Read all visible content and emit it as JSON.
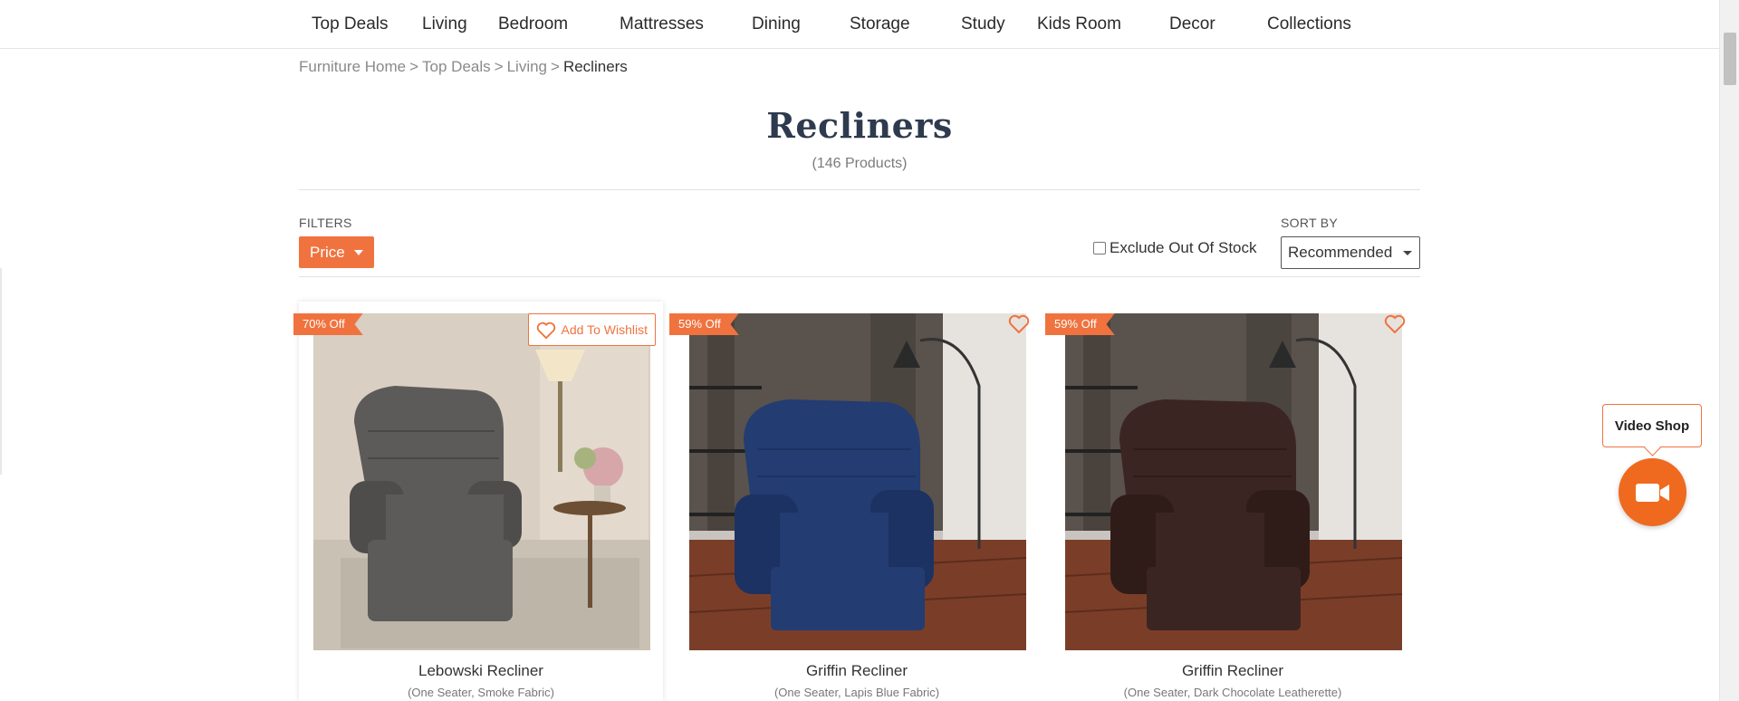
{
  "nav": {
    "items": [
      "Top Deals",
      "Living",
      "Bedroom",
      "Mattresses",
      "Dining",
      "Storage",
      "Study",
      "Kids Room",
      "Decor",
      "Collections"
    ]
  },
  "breadcrumb": {
    "items": [
      "Furniture Home",
      "Top Deals",
      "Living"
    ],
    "current": "Recliners",
    "separator": ">"
  },
  "page": {
    "title": "Recliners",
    "count": "(146 Products)"
  },
  "filters": {
    "label": "FILTERS",
    "price_label": "Price",
    "exclude_label": "Exclude Out Of Stock",
    "sort_label": "SORT BY",
    "sort_value": "Recommended"
  },
  "products": [
    {
      "badge": "70% Off",
      "wishlist": "Add To Wishlist",
      "name": "Lebowski Recliner",
      "variant": "(One Seater, Smoke Fabric)",
      "color": "#5d5b59"
    },
    {
      "badge": "59% Off",
      "wishlist": "",
      "name": "Griffin Recliner",
      "variant": "(One Seater, Lapis Blue Fabric)",
      "color": "#233c72"
    },
    {
      "badge": "59% Off",
      "wishlist": "",
      "name": "Griffin Recliner",
      "variant": "(One Seater, Dark Chocolate Leatherette)",
      "color": "#3b2522"
    }
  ],
  "video_shop": {
    "label": "Video Shop",
    "icon": "video-camera-icon"
  },
  "colors": {
    "accent": "#f0733f",
    "title": "#2e3a4d"
  }
}
